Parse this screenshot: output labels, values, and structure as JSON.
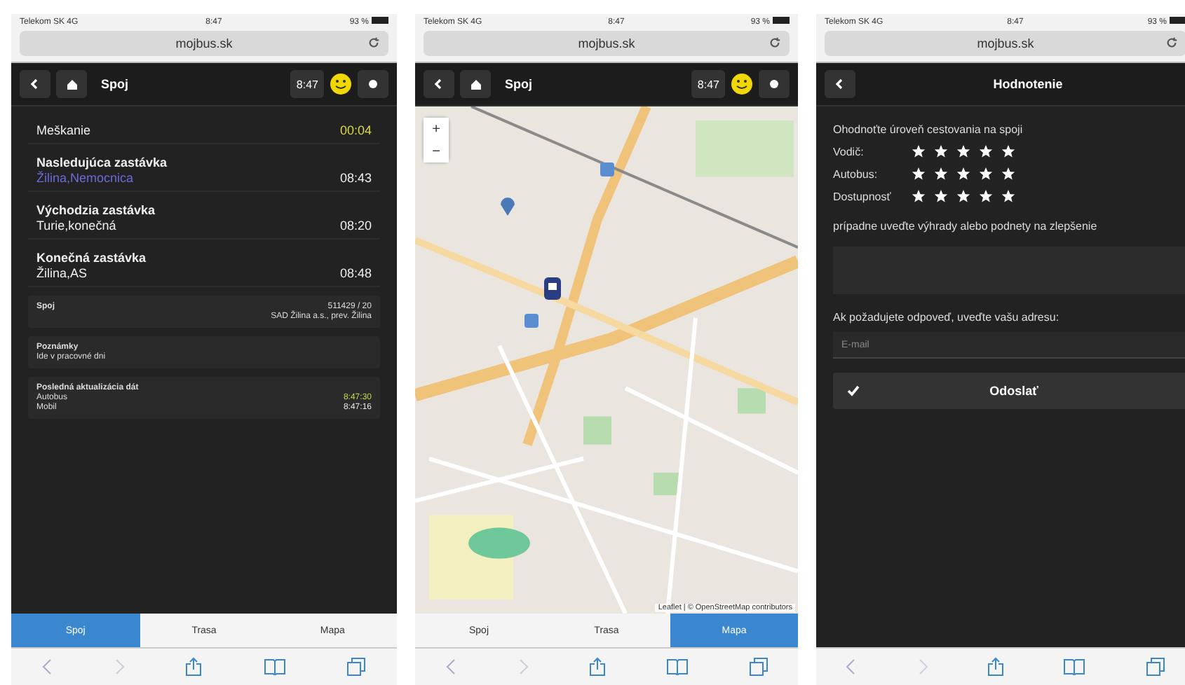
{
  "phones": [
    {
      "kind": "details",
      "status": {
        "carrier": "Telekom SK 4G",
        "time": "8:47",
        "battery": "93 %"
      },
      "address": "mojbus.sk",
      "header": {
        "title": "Spoj",
        "clock": "8:47",
        "home": true,
        "menu": true
      },
      "rows": [
        {
          "kind": "simple",
          "label": "Meškanie",
          "value": "00:04"
        },
        {
          "kind": "stop",
          "label": "Nasledujúca zastávka",
          "name": "Žilina,Nemocnica",
          "value": "08:43",
          "current": true
        },
        {
          "kind": "stop",
          "label": "Východzia zastávka",
          "name": "Turie,konečná",
          "value": "08:20",
          "current": false
        },
        {
          "kind": "stop",
          "label": "Konečná zastávka",
          "name": "Žilina,AS",
          "value": "08:48",
          "current": false
        }
      ],
      "boxes": [
        {
          "kind": "line",
          "label": "Spoj",
          "lines": [
            "511429 / 20",
            "SAD Žilina a.s., prev. Žilina"
          ]
        },
        {
          "kind": "note",
          "label": "Poznámky",
          "text": "Ide v pracovné dni"
        },
        {
          "kind": "update",
          "label": "Posledná aktualizácia dát",
          "items": [
            {
              "name": "Autobus",
              "value": "8:47:30",
              "color": "#c8d84a"
            },
            {
              "name": "Mobil",
              "value": "8:47:16",
              "color": "#e8e8e8"
            }
          ]
        }
      ],
      "tabs": [
        {
          "label": "Spoj",
          "selected": true
        },
        {
          "label": "Trasa",
          "selected": false
        },
        {
          "label": "Mapa",
          "selected": false
        }
      ]
    },
    {
      "kind": "map",
      "status": {
        "carrier": "Telekom SK 4G",
        "time": "8:47",
        "battery": "93 %"
      },
      "address": "mojbus.sk",
      "header": {
        "title": "Spoj",
        "clock": "8:47",
        "home": true,
        "menu": true
      },
      "zoom": [
        "+",
        "−"
      ],
      "attribution": "Leaflet | © OpenStreetMap contributors",
      "tabs": [
        {
          "label": "Spoj",
          "selected": false
        },
        {
          "label": "Trasa",
          "selected": false
        },
        {
          "label": "Mapa",
          "selected": true
        }
      ]
    },
    {
      "kind": "rating",
      "status": {
        "carrier": "Telekom SK 4G",
        "time": "8:47",
        "battery": "93 %"
      },
      "address": "mojbus.sk",
      "header": {
        "title": "Hodnotenie",
        "home": false,
        "menu": false
      },
      "prompt": "Ohodnoťte úroveň cestovania na spoji",
      "ratings": [
        {
          "label": "Vodič:",
          "stars": 5
        },
        {
          "label": "Autobus:",
          "stars": 5
        },
        {
          "label": "Dostupnosť",
          "stars": 5
        }
      ],
      "comment_label": "prípadne uveďte výhrady alebo podnety na zlepšenie",
      "email_label": "Ak požadujete odpoveď, uveďte vašu adresu:",
      "email": {
        "placeholder": "E-mail"
      },
      "submit": "Odoslať"
    }
  ]
}
